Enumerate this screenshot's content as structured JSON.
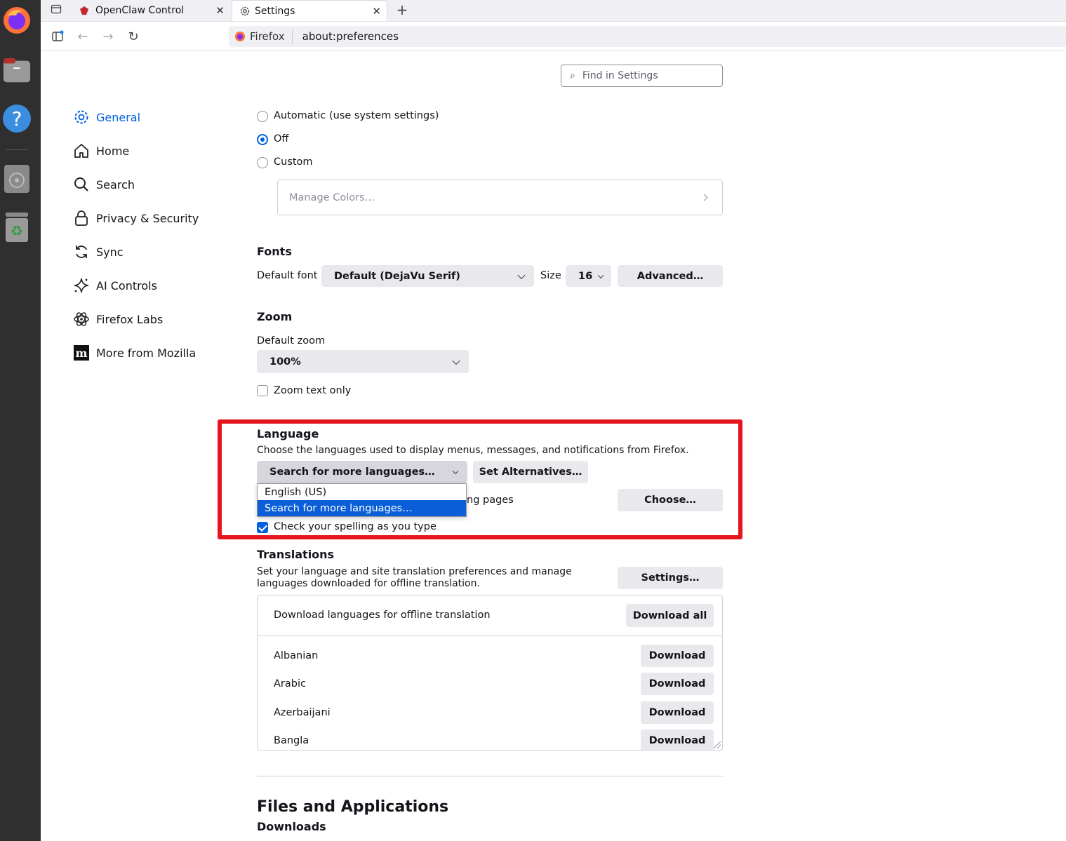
{
  "colors": {
    "accent": "#0061e0",
    "highlight_box": "#e5151f",
    "dock_bg": "#2f2f2f"
  },
  "tabs": [
    {
      "title": "OpenClaw Control",
      "icon": "openclaw-icon"
    },
    {
      "title": "Settings",
      "icon": "gear-icon"
    }
  ],
  "urlbar": {
    "identity": "Firefox",
    "url": "about:preferences"
  },
  "find": {
    "placeholder": "Find in Settings"
  },
  "sidebar": {
    "items": [
      {
        "label": "General",
        "icon": "gear-icon"
      },
      {
        "label": "Home",
        "icon": "home-icon"
      },
      {
        "label": "Search",
        "icon": "search-icon"
      },
      {
        "label": "Privacy & Security",
        "icon": "lock-icon"
      },
      {
        "label": "Sync",
        "icon": "sync-icon"
      },
      {
        "label": "AI Controls",
        "icon": "sparkle-icon"
      },
      {
        "label": "Firefox Labs",
        "icon": "atom-icon"
      },
      {
        "label": "More from Mozilla",
        "icon": "mozilla-icon"
      }
    ]
  },
  "contrast": {
    "options": [
      "Automatic (use system settings)",
      "Off",
      "Custom"
    ],
    "selected": "Off",
    "manage_colors": "Manage Colors…"
  },
  "fonts": {
    "heading": "Fonts",
    "default_font_label": "Default font",
    "default_font_value": "Default (DejaVu Serif)",
    "size_label": "Size",
    "size_value": "16",
    "advanced_button": "Advanced…"
  },
  "zoom": {
    "heading": "Zoom",
    "default_zoom_label": "Default zoom",
    "default_zoom_value": "100%",
    "zoom_text_only_label": "Zoom text only",
    "zoom_text_only_checked": false
  },
  "language": {
    "heading": "Language",
    "description": "Choose the languages used to display menus, messages, and notifications from Firefox.",
    "select_value": "Search for more languages…",
    "set_alternatives_button": "Set Alternatives…",
    "dropdown_options": [
      "English (US)",
      "Search for more languages…"
    ],
    "partial_text": "ng pages",
    "choose_button": "Choose…",
    "spellcheck_label": "Check your spelling as you type",
    "spellcheck_checked": true
  },
  "translations": {
    "heading": "Translations",
    "description": "Set your language and site translation preferences and manage languages downloaded for offline translation.",
    "settings_button": "Settings…",
    "download_header": "Download languages for offline translation",
    "download_all_button": "Download all",
    "download_button": "Download",
    "languages": [
      "Albanian",
      "Arabic",
      "Azerbaijani",
      "Bangla"
    ]
  },
  "files": {
    "heading": "Files and Applications",
    "downloads_heading": "Downloads"
  }
}
